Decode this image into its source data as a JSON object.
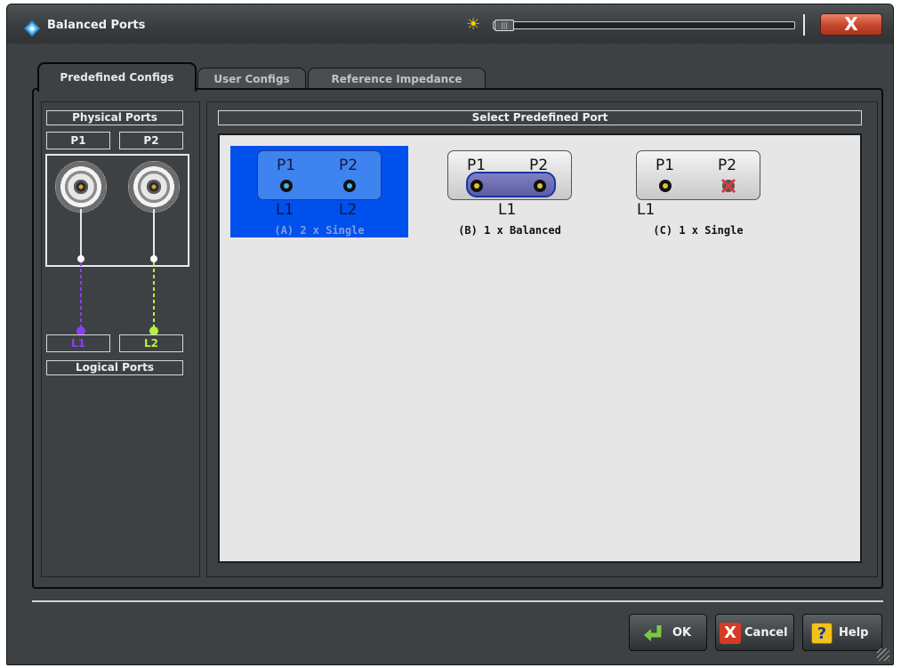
{
  "window": {
    "title": "Balanced Ports",
    "close_label": "X"
  },
  "tabs": [
    {
      "label": "Predefined Configs",
      "active": true
    },
    {
      "label": "User Configs",
      "active": false
    },
    {
      "label": "Reference Impedance",
      "active": false
    }
  ],
  "left": {
    "physical_ports_label": "Physical Ports",
    "p1": "P1",
    "p2": "P2",
    "l1": "L1",
    "l2": "L2",
    "logical_ports_label": "Logical Ports",
    "colors": {
      "l1": "#8b3dff",
      "l2": "#b6f23a"
    }
  },
  "right": {
    "header": "Select Predefined Port",
    "options": [
      {
        "caption": "(A) 2 x Single",
        "ports": [
          "P1",
          "P2"
        ],
        "logical": [
          "L1",
          "L2"
        ],
        "selected": true
      },
      {
        "caption": "(B) 1 x Balanced",
        "ports": [
          "P1",
          "P2"
        ],
        "logical": [
          "L1"
        ],
        "selected": false
      },
      {
        "caption": "(C) 1 x Single",
        "ports": [
          "P1",
          "P2"
        ],
        "logical": [
          "L1"
        ],
        "selected": false
      }
    ]
  },
  "buttons": {
    "ok": "OK",
    "cancel": "Cancel",
    "help": "Help"
  },
  "icons": {
    "app": "balanced-ports-icon",
    "brightness": "sun-icon",
    "ok": "enter-arrow-icon",
    "cancel": "x-icon",
    "help": "question-icon"
  }
}
